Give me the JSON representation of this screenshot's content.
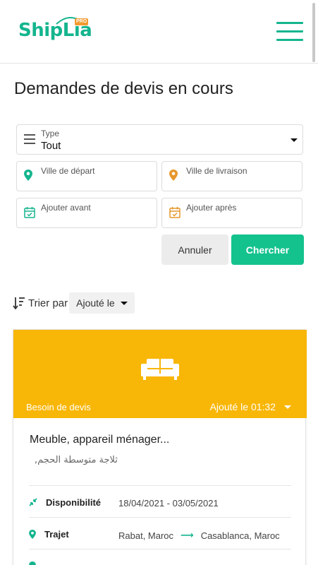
{
  "brand": {
    "name": "ShipLia",
    "badge": "PRO",
    "color": "#14b58e"
  },
  "page": {
    "title": "Demandes de devis en cours"
  },
  "filters": {
    "type_label": "Type",
    "type_value": "Tout",
    "departure_placeholder": "Ville de départ",
    "delivery_placeholder": "Ville de livraison",
    "before_placeholder": "Ajouter avant",
    "after_placeholder": "Ajouter après",
    "cancel_label": "Annuler",
    "search_label": "Chercher"
  },
  "sort": {
    "label": "Trier par",
    "value": "Ajouté le"
  },
  "card": {
    "banner_color": "#f8b606",
    "status": "Besoin de devis",
    "added": "Ajouté le 01:32",
    "title": "Meuble, appareil ménager...",
    "subtitle": "ثلاجة متوسطة الحجم,",
    "availability_label": "Disponibilité",
    "availability_value": "18/04/2021 - 03/05/2021",
    "route_label": "Trajet",
    "route_from": "Rabat, Maroc",
    "route_arrow": "⟶",
    "route_to": "Casablanca, Maroc"
  }
}
